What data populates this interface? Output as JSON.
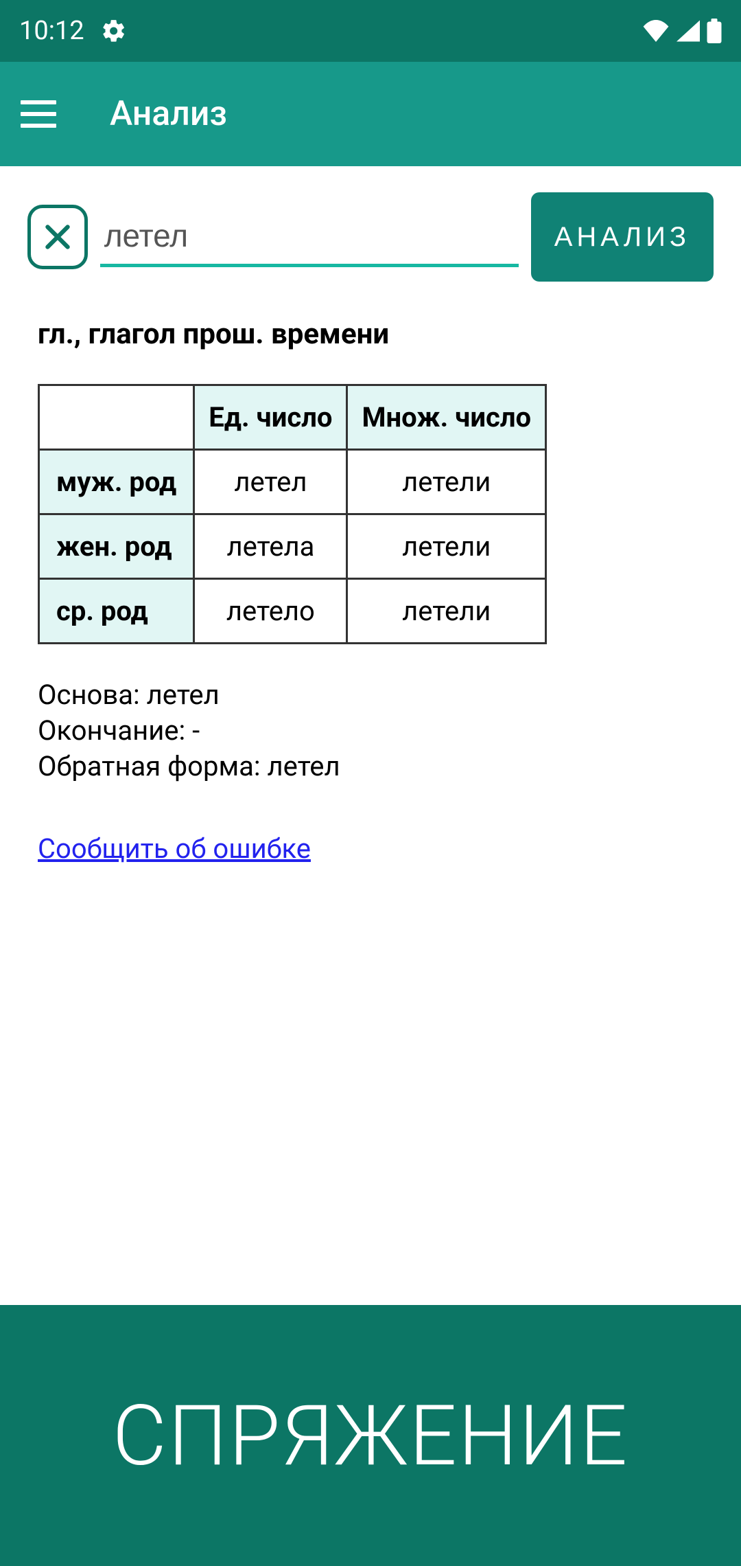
{
  "status": {
    "time": "10:12"
  },
  "header": {
    "title": "Анализ"
  },
  "search": {
    "value": "летел",
    "button": "АНАЛИЗ"
  },
  "result": {
    "pos": "гл., глагол прош. времени",
    "table": {
      "col_singular": "Ед. число",
      "col_plural": "Множ. число",
      "rows": [
        {
          "label": "муж. род",
          "singular": "летел",
          "plural": "летели"
        },
        {
          "label": "жен. род",
          "singular": "летела",
          "plural": "летели"
        },
        {
          "label": "ср. род",
          "singular": "летело",
          "plural": "летели"
        }
      ]
    },
    "info": {
      "base": "Основа: летел",
      "ending": "Окончание: -",
      "reverse": "Обратная форма: летел"
    },
    "report_link": "Сообщить об ошибке"
  },
  "footer": {
    "banner": "СПРЯЖЕНИЕ"
  }
}
